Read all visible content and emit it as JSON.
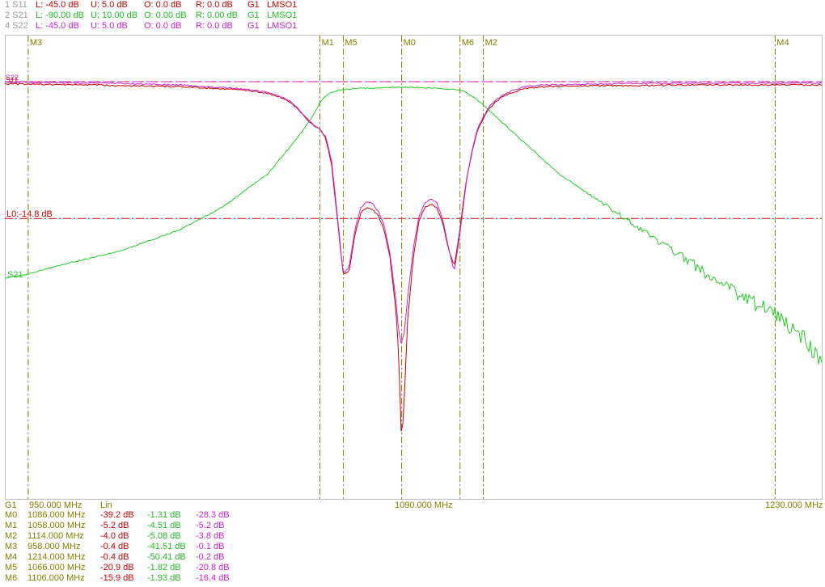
{
  "traces": [
    {
      "id": "1 S11",
      "lower": "L: -45.0 dB",
      "upper": "U: 5.0 dB",
      "offset": "O: 0.0 dB",
      "ref": "R: 0.0 dB",
      "group": "G1",
      "format": "LMSO1"
    },
    {
      "id": "2 S21",
      "lower": "L: -90.00 dB",
      "upper": "U: 10.00 dB",
      "offset": "O: 0.00 dB",
      "ref": "R: 0.00 dB",
      "group": "G1",
      "format": "LMSO1"
    },
    {
      "id": "4 S22",
      "lower": "L: -45.0 dB",
      "upper": "U: 5.0 dB",
      "offset": "O: 0.0 dB",
      "ref": "R: 0.0 dB",
      "group": "G1",
      "format": "LMSO1"
    }
  ],
  "colors": {
    "s11": "#cc0000",
    "s21": "#22cc22",
    "s22": "#cc22cc",
    "marker": "#808000",
    "trace1_id": "#a0a0a0"
  },
  "axis": {
    "group": "G1",
    "start": "950.000 MHz",
    "center": "1090.000 MHz",
    "stop": "1230.000 MHz",
    "scale": "Lin"
  },
  "limit_label": "L0:-14.8 dB",
  "trace_labels": {
    "s21": "S21",
    "s11": "S11",
    "s22": "S22"
  },
  "markers_table": [
    {
      "name": "M0",
      "freq": "1086.000 MHz",
      "s11": "-39.2 dB",
      "s21": "-1.31 dB",
      "s22": "-28.3 dB"
    },
    {
      "name": "M1",
      "freq": "1058.000 MHz",
      "s11": "-5.2 dB",
      "s21": "-4.51 dB",
      "s22": "-5.2 dB"
    },
    {
      "name": "M2",
      "freq": "1114.000 MHz",
      "s11": "-4.0 dB",
      "s21": "-5.08 dB",
      "s22": "-3.8 dB"
    },
    {
      "name": "M3",
      "freq": "958.000 MHz",
      "s11": "-0.4 dB",
      "s21": "-41.51 dB",
      "s22": "-0.1 dB"
    },
    {
      "name": "M4",
      "freq": "1214.000 MHz",
      "s11": "-0.4 dB",
      "s21": "-50.41 dB",
      "s22": "-0.2 dB"
    },
    {
      "name": "M5",
      "freq": "1066.000 MHz",
      "s11": "-20.9 dB",
      "s21": "-1.82 dB",
      "s22": "-20.8 dB"
    },
    {
      "name": "M6",
      "freq": "1106.000 MHz",
      "s11": "-15.9 dB",
      "s21": "-1.93 dB",
      "s22": "-16.4 dB"
    }
  ],
  "chart_data": {
    "type": "line",
    "xlim": [
      950,
      1230
    ],
    "grid": false,
    "limit_line_db": -14.8,
    "markers": [
      {
        "name": "M3",
        "x": 958
      },
      {
        "name": "M1",
        "x": 1058
      },
      {
        "name": "M5",
        "x": 1066
      },
      {
        "name": "M0",
        "x": 1086
      },
      {
        "name": "M6",
        "x": 1106
      },
      {
        "name": "M2",
        "x": 1114
      },
      {
        "name": "M4",
        "x": 1214
      }
    ],
    "series": [
      {
        "name": "S11",
        "axis": "s11",
        "ylim": [
          -45,
          5
        ],
        "x": [
          950,
          980,
          1010,
          1030,
          1040,
          1045,
          1048,
          1050,
          1052,
          1054,
          1056,
          1058,
          1060,
          1062,
          1064,
          1066,
          1068,
          1070,
          1072,
          1074,
          1076,
          1078,
          1080,
          1082,
          1084,
          1085,
          1086,
          1087,
          1088,
          1090,
          1092,
          1094,
          1096,
          1098,
          1100,
          1102,
          1104,
          1106,
          1108,
          1110,
          1112,
          1114,
          1116,
          1118,
          1120,
          1124,
          1128,
          1135,
          1150,
          1190,
          1230
        ],
        "y": [
          -0.3,
          -0.4,
          -0.6,
          -0.9,
          -1.3,
          -1.8,
          -2.3,
          -2.9,
          -3.6,
          -4.3,
          -4.8,
          -5.2,
          -6.2,
          -9.0,
          -15.0,
          -20.9,
          -20.5,
          -16.5,
          -14.2,
          -13.6,
          -13.8,
          -14.5,
          -16.0,
          -19.0,
          -24.5,
          -29.5,
          -39.2,
          -33.5,
          -26.0,
          -19.0,
          -15.0,
          -13.6,
          -13.2,
          -13.6,
          -15.2,
          -18.0,
          -20.0,
          -15.9,
          -11.0,
          -7.8,
          -5.3,
          -4.0,
          -3.0,
          -2.3,
          -1.8,
          -1.2,
          -0.8,
          -0.6,
          -0.5,
          -0.4,
          -0.4
        ]
      },
      {
        "name": "S21",
        "axis": "s21",
        "ylim": [
          -90,
          10
        ],
        "x": [
          950,
          958,
          970,
          990,
          1010,
          1025,
          1040,
          1050,
          1056,
          1058,
          1060,
          1062,
          1064,
          1066,
          1070,
          1080,
          1086,
          1095,
          1100,
          1104,
          1106,
          1108,
          1110,
          1112,
          1114,
          1118,
          1125,
          1140,
          1160,
          1180,
          1200,
          1214,
          1220,
          1230
        ],
        "y": [
          -42.5,
          -41.51,
          -39.5,
          -36.5,
          -32.0,
          -27.0,
          -20.0,
          -12.5,
          -7.0,
          -4.51,
          -3.2,
          -2.5,
          -2.0,
          -1.82,
          -1.6,
          -1.4,
          -1.31,
          -1.4,
          -1.6,
          -1.8,
          -1.93,
          -2.4,
          -3.2,
          -4.1,
          -5.08,
          -7.5,
          -11.5,
          -20.0,
          -28.5,
          -37.0,
          -45.5,
          -50.41,
          -53.0,
          -60.0
        ]
      },
      {
        "name": "S22",
        "axis": "s22",
        "ylim": [
          -45,
          5
        ],
        "x": [
          950,
          980,
          1010,
          1030,
          1040,
          1045,
          1048,
          1050,
          1052,
          1054,
          1056,
          1058,
          1060,
          1062,
          1064,
          1066,
          1068,
          1070,
          1072,
          1074,
          1076,
          1078,
          1080,
          1082,
          1084,
          1085,
          1086,
          1087,
          1088,
          1090,
          1092,
          1094,
          1096,
          1098,
          1100,
          1102,
          1104,
          1106,
          1108,
          1110,
          1112,
          1114,
          1116,
          1118,
          1120,
          1124,
          1128,
          1135,
          1150,
          1190,
          1230
        ],
        "y": [
          -0.1,
          -0.2,
          -0.4,
          -0.8,
          -1.2,
          -1.7,
          -2.2,
          -2.8,
          -3.5,
          -4.2,
          -4.7,
          -5.2,
          -6.0,
          -8.6,
          -14.6,
          -20.8,
          -20.0,
          -16.0,
          -13.6,
          -13.0,
          -13.2,
          -14.0,
          -15.5,
          -18.5,
          -23.5,
          -27.0,
          -28.3,
          -26.8,
          -23.5,
          -18.0,
          -14.5,
          -13.1,
          -12.7,
          -13.1,
          -14.8,
          -17.8,
          -20.5,
          -16.4,
          -11.2,
          -7.6,
          -5.1,
          -3.8,
          -2.8,
          -2.1,
          -1.6,
          -1.0,
          -0.6,
          -0.4,
          -0.3,
          -0.2,
          -0.2
        ]
      }
    ]
  }
}
